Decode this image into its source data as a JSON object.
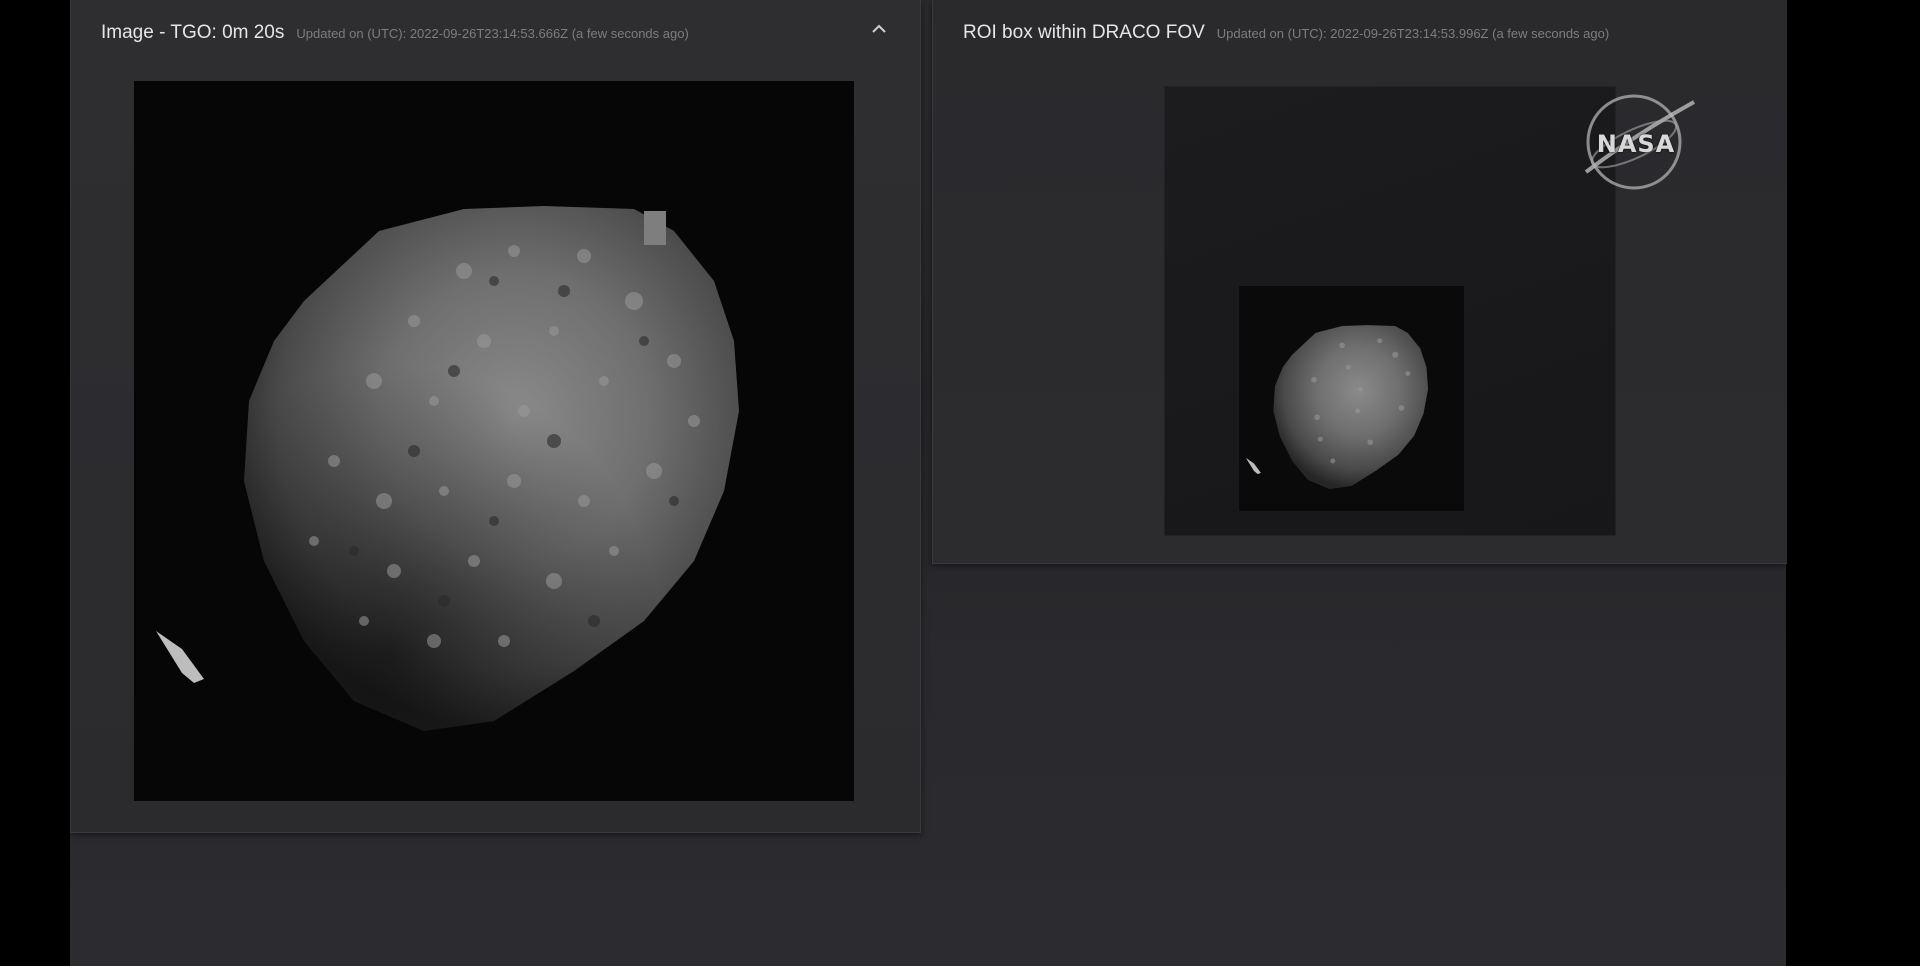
{
  "left_panel": {
    "title": "Image - TGO: 0m 20s",
    "updated": "Updated on (UTC): 2022-09-26T23:14:53.666Z (a few seconds ago)",
    "collapse_icon": "chevron-up-icon",
    "image_subject": "asteroid-image"
  },
  "right_panel": {
    "title": "ROI box within DRACO FOV",
    "updated": "Updated on (UTC): 2022-09-26T23:14:53.996Z (a few seconds ago)",
    "image_subject": "asteroid-image",
    "logo": "NASA"
  },
  "colors": {
    "background": "#2a2a2d",
    "panel": "#2e2e31",
    "title_text": "#e6e6e6",
    "meta_text": "#7d7d80"
  }
}
